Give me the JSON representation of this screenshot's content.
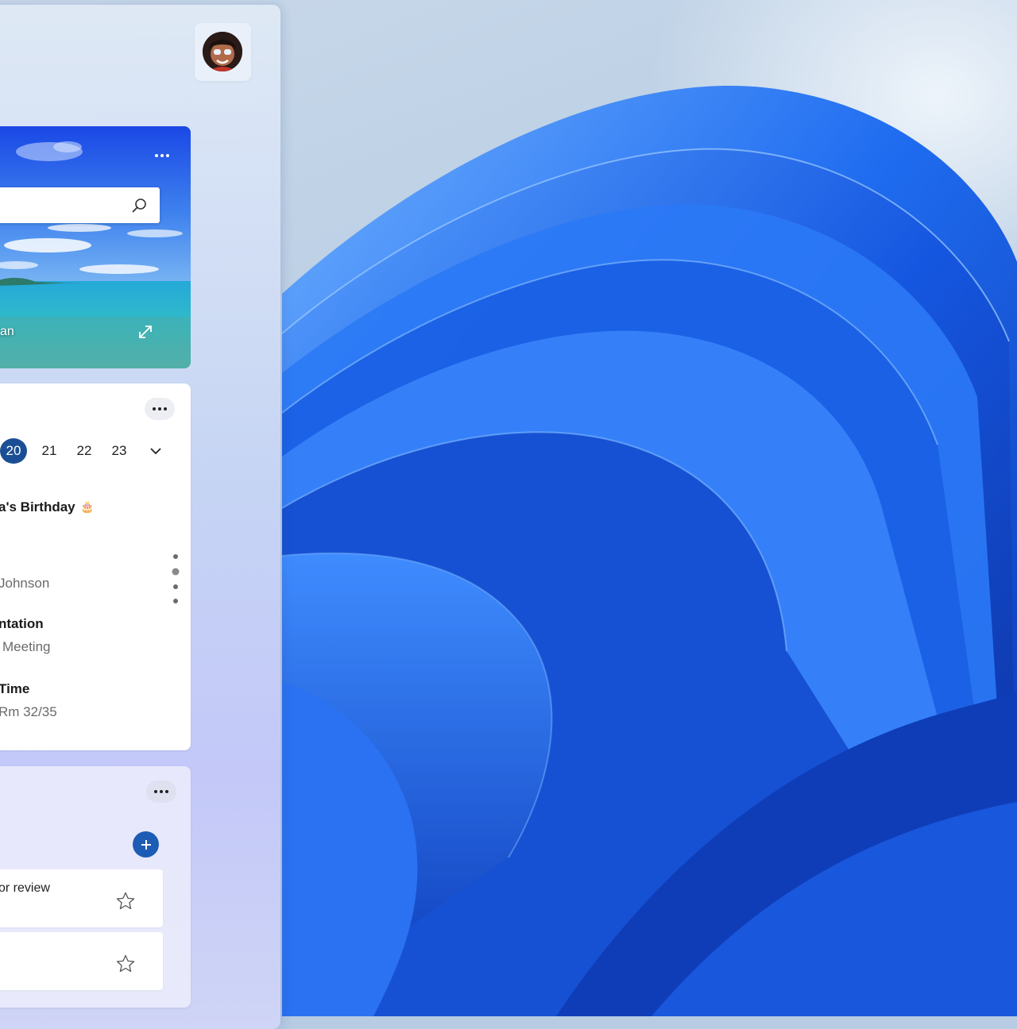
{
  "search_card": {
    "search_placeholder": "",
    "photo_caption": "an"
  },
  "calendar": {
    "dates": [
      {
        "day": "20",
        "selected": true
      },
      {
        "day": "21",
        "selected": false
      },
      {
        "day": "22",
        "selected": false
      },
      {
        "day": "23",
        "selected": false
      }
    ],
    "events": [
      {
        "title": "a's Birthday",
        "emoji": "🎂"
      },
      {
        "subtitle": "Johnson"
      },
      {
        "title": "ntation",
        "subtitle": "Meeting"
      },
      {
        "title": "Time",
        "subtitle": "Rm 32/35"
      }
    ]
  },
  "tasks": {
    "items": [
      {
        "label": "or review"
      },
      {
        "label": ""
      }
    ]
  },
  "colors": {
    "accent": "#1b4f95",
    "add_button": "#1c5cb4",
    "wallpaper_bloom": "#1e63e6"
  }
}
